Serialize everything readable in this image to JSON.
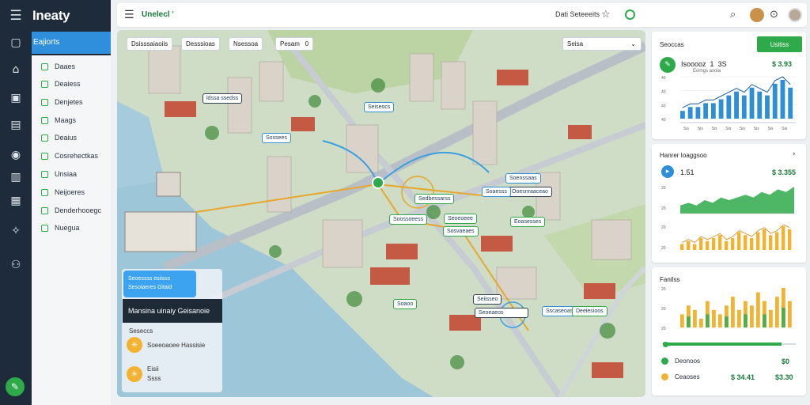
{
  "app": {
    "brand": "Ineaty"
  },
  "rail": {
    "icons": [
      "menu-icon",
      "chat-icon",
      "home-icon",
      "chart-icon",
      "briefcase-icon",
      "eye-icon",
      "document-icon",
      "layers-icon",
      "network-icon",
      "users-icon"
    ],
    "fab_icon": "leaf-icon"
  },
  "nav": {
    "active": "Eajiorts",
    "items": [
      "Daaes",
      "Deaiess",
      "Denjetes",
      "Maags",
      "Deaius",
      "Cosrehectkas",
      "Unsiaa",
      "Neijoeres",
      "Denderhooegc",
      "Nuegua"
    ]
  },
  "topbar": {
    "title": "Unelecl",
    "title_mark": "'",
    "session": "Dati Seteeeits"
  },
  "map": {
    "chips": [
      "Dsisssaiaoiis",
      "Desssioas",
      "Nsessoa",
      "Pesam",
      "Seisa"
    ],
    "chip_badge": "0",
    "tags": [
      "ldssa ssedss",
      "Seiseocs",
      "Sossees",
      "Soenssaas",
      "Ooesnraaceao",
      "Soaesss",
      "Sedbessarss",
      "Seoeoeee",
      "Eoasesses",
      "Soossoeess",
      "Sosvaeaes",
      "Seiisseo",
      "Seoeaeos",
      "Soaoo",
      "Sscaseoasa",
      "Deeiesioos"
    ],
    "overlay": {
      "blue_line1": "Seoessss esiisss",
      "blue_line2": "Sesoiaeres Gitaid",
      "dark_title": "Mansina uinaiy Geisanoie",
      "label": "Seseccs",
      "row1": "Soeeoaoee Hassisie",
      "row2_a": "Eisii",
      "row2_b": "Ssss"
    }
  },
  "cards": {
    "c1": {
      "title": "Seoccas",
      "button": "Usitiss",
      "kpi_label": "Isooooz",
      "kpi_num": "1",
      "kpi_small": "3S",
      "kpi_sub": "Eorngs asoia",
      "value": "$ 3.93"
    },
    "c2": {
      "title": "Hanrer Ioaggsoo",
      "kpi": "1.51",
      "value": "$ 3.355"
    },
    "c3": {
      "title": "Fanilss",
      "legend1": "Deonoos",
      "legend1_val": "$0",
      "legend2": "Ceaoses",
      "legend2_a": "$ 34.41",
      "legend2_b": "$3.30"
    }
  },
  "colors": {
    "accent": "#2eaa4a",
    "blue": "#2e8fd6",
    "dark": "#1e2b3a",
    "orange": "#f3b230"
  },
  "chart_data": [
    {
      "type": "bar",
      "title": "Seoccas",
      "categories": [
        "Sis",
        "Sis",
        "Sis",
        "Sis",
        "Sis",
        "Sis",
        "Sis",
        "Sis"
      ],
      "series": [
        {
          "values": [
            2,
            3,
            3,
            4,
            4,
            5,
            6,
            7,
            6,
            8,
            7,
            6,
            9,
            10,
            8
          ]
        }
      ],
      "ylabels": [
        "40",
        "40",
        "40",
        "40"
      ]
    },
    {
      "type": "area",
      "title": "Hanrer Ioaggsoo",
      "series": [
        {
          "values": [
            3,
            4,
            3,
            5,
            4,
            6,
            5,
            6,
            7,
            6,
            8,
            7,
            9,
            8,
            10
          ]
        }
      ],
      "ylabels": [
        "20",
        "20"
      ]
    },
    {
      "type": "bar",
      "series": [
        {
          "values": [
            2,
            3,
            2,
            4,
            3,
            4,
            5,
            3,
            4,
            6,
            5,
            4,
            6,
            7,
            5,
            6,
            8,
            7
          ]
        }
      ],
      "ylabels": [
        "20",
        "20"
      ]
    },
    {
      "type": "bar",
      "title": "Fanilss",
      "series": [
        {
          "values": [
            3,
            5,
            4,
            2,
            6,
            4,
            3,
            5,
            7,
            4,
            6,
            5,
            8,
            6,
            4,
            7,
            9,
            6
          ]
        }
      ],
      "ylabels": [
        "20",
        "20",
        "20"
      ]
    }
  ]
}
